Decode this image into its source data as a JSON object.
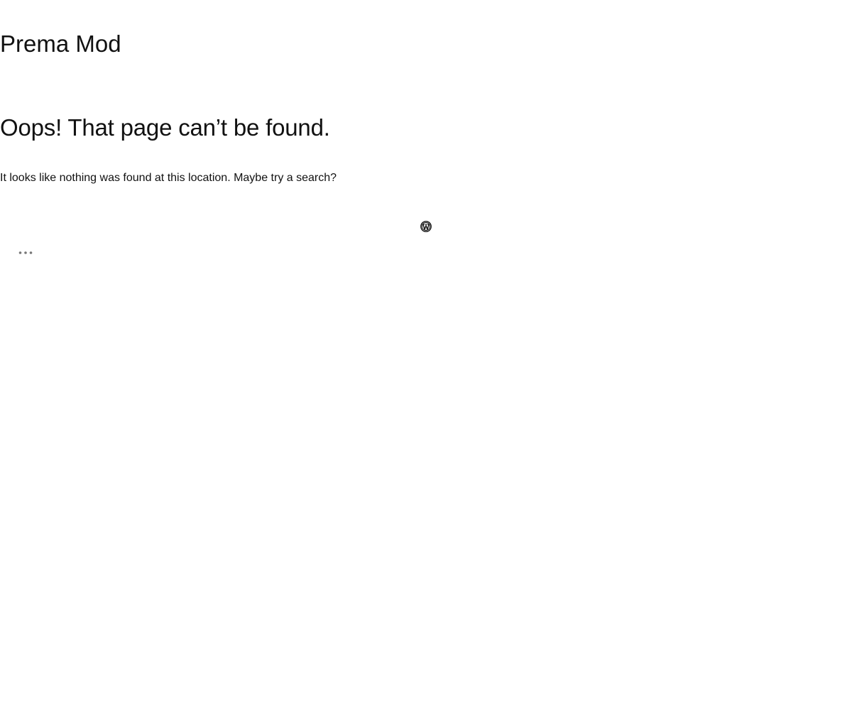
{
  "site": {
    "title": "Prema Mod"
  },
  "error_page": {
    "heading": "Oops! That page can’t be found.",
    "message": "It looks like nothing was found at this location. Maybe try a search?"
  },
  "footer": {
    "logo_icon": "wordpress-icon"
  },
  "actions": {
    "more_icon": "ellipsis-icon"
  },
  "colors": {
    "text": "#111111",
    "background": "#ffffff",
    "muted_icon": "#777777"
  }
}
